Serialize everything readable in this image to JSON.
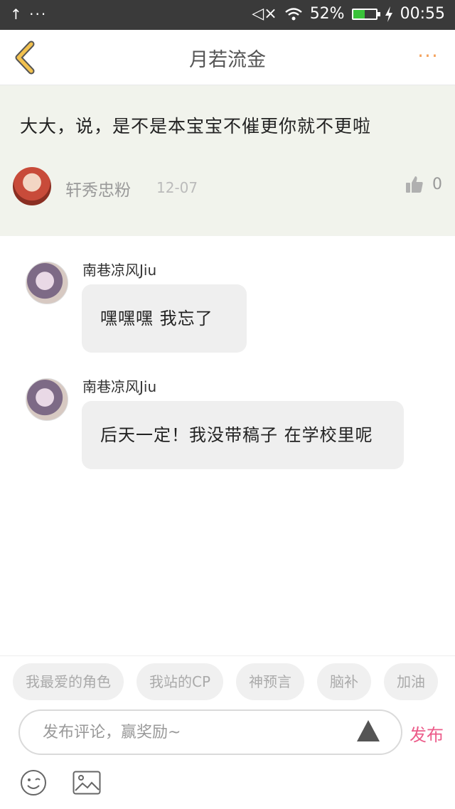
{
  "status_bar": {
    "left_icons": "↑ ···",
    "signal_text": "◁×",
    "battery_percent": "52%",
    "battery_level": 0.52,
    "time": "00:55"
  },
  "nav": {
    "title": "月若流金",
    "more": "···"
  },
  "post": {
    "text": "大大，说，是不是本宝宝不催更你就不更啦",
    "author": "轩秀忠粉",
    "date": "12-07",
    "likes": "0"
  },
  "comments": [
    {
      "author": "南巷凉风Jiu",
      "text": "嘿嘿嘿 我忘了"
    },
    {
      "author": "南巷凉风Jiu",
      "text": "后天一定！我没带稿子 在学校里呢"
    }
  ],
  "tags": [
    "我最爱的角色",
    "我站的CP",
    "神预言",
    "脑补",
    "加油"
  ],
  "input": {
    "placeholder": "发布评论，赢奖励~",
    "publish_label": "发布"
  },
  "colors": {
    "accent": "#ec5c8a",
    "back_arrow": "#f2c14e",
    "more_dots": "#f4a460",
    "post_bg": "#f1f3ec"
  }
}
